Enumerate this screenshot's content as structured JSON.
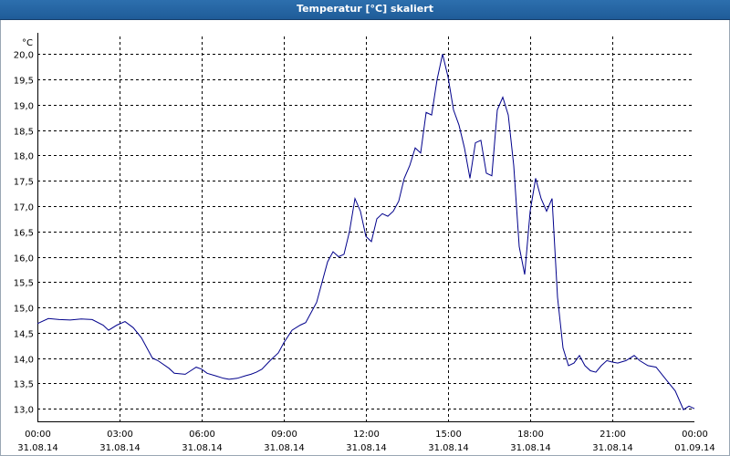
{
  "window": {
    "title": "Temperatur [°C] skaliert"
  },
  "chart_data": {
    "type": "line",
    "title": "Temperatur [°C] skaliert",
    "ylabel": "°C",
    "xlabel": "",
    "ylim": [
      12.75,
      20.35
    ],
    "xlim": [
      0,
      24
    ],
    "grid": true,
    "y_ticks": [
      {
        "value": 13.0,
        "label": "13,0"
      },
      {
        "value": 13.5,
        "label": "13,5"
      },
      {
        "value": 14.0,
        "label": "14,0"
      },
      {
        "value": 14.5,
        "label": "14,5"
      },
      {
        "value": 15.0,
        "label": "15,0"
      },
      {
        "value": 15.5,
        "label": "15,5"
      },
      {
        "value": 16.0,
        "label": "16,0"
      },
      {
        "value": 16.5,
        "label": "16,5"
      },
      {
        "value": 17.0,
        "label": "17,0"
      },
      {
        "value": 17.5,
        "label": "17,5"
      },
      {
        "value": 18.0,
        "label": "18,0"
      },
      {
        "value": 18.5,
        "label": "18,5"
      },
      {
        "value": 19.0,
        "label": "19,0"
      },
      {
        "value": 19.5,
        "label": "19,5"
      },
      {
        "value": 20.0,
        "label": "20,0"
      }
    ],
    "x_ticks": [
      {
        "value": 0,
        "time": "00:00",
        "date": "31.08.14"
      },
      {
        "value": 3,
        "time": "03:00",
        "date": "31.08.14"
      },
      {
        "value": 6,
        "time": "06:00",
        "date": "31.08.14"
      },
      {
        "value": 9,
        "time": "09:00",
        "date": "31.08.14"
      },
      {
        "value": 12,
        "time": "12:00",
        "date": "31.08.14"
      },
      {
        "value": 15,
        "time": "15:00",
        "date": "31.08.14"
      },
      {
        "value": 18,
        "time": "18:00",
        "date": "31.08.14"
      },
      {
        "value": 21,
        "time": "21:00",
        "date": "31.08.14"
      },
      {
        "value": 24,
        "time": "00:00",
        "date": "01.09.14"
      }
    ],
    "colors": {
      "line": "#00008b",
      "grid": "#000000",
      "axis": "#000000"
    },
    "series": [
      {
        "x": [
          0.0,
          0.4,
          0.8,
          1.2,
          1.6,
          2.0,
          2.4,
          2.6,
          2.9,
          3.2,
          3.5,
          3.8,
          4.0,
          4.2,
          4.4,
          4.8,
          5.0,
          5.4,
          5.6,
          5.8,
          6.0,
          6.2,
          6.5,
          6.8,
          7.0,
          7.3,
          7.6,
          7.8,
          8.0,
          8.2,
          8.5,
          8.8,
          9.0,
          9.3,
          9.6,
          9.8,
          10.0,
          10.2,
          10.4,
          10.6,
          10.8,
          11.0,
          11.2,
          11.4,
          11.6,
          11.8,
          12.0,
          12.2,
          12.4,
          12.6,
          12.8,
          13.0,
          13.2,
          13.4,
          13.6,
          13.8,
          14.0,
          14.2,
          14.4,
          14.6,
          14.8,
          15.0,
          15.2,
          15.4,
          15.6,
          15.8,
          16.0,
          16.2,
          16.4,
          16.6,
          16.8,
          17.0,
          17.2,
          17.4,
          17.6,
          17.8,
          18.0,
          18.2,
          18.4,
          18.6,
          18.8,
          19.0,
          19.2,
          19.4,
          19.6,
          19.8,
          20.0,
          20.2,
          20.4,
          20.6,
          20.8,
          21.0,
          21.2,
          21.5,
          21.8,
          22.0,
          22.3,
          22.6,
          23.0,
          23.3,
          23.6,
          23.8,
          24.0
        ],
        "y": [
          14.68,
          14.78,
          14.76,
          14.75,
          14.77,
          14.76,
          14.65,
          14.55,
          14.65,
          14.72,
          14.6,
          14.4,
          14.2,
          14.0,
          13.95,
          13.8,
          13.7,
          13.68,
          13.75,
          13.82,
          13.78,
          13.7,
          13.65,
          13.6,
          13.58,
          13.6,
          13.65,
          13.68,
          13.72,
          13.78,
          13.95,
          14.1,
          14.3,
          14.55,
          14.65,
          14.7,
          14.9,
          15.1,
          15.5,
          15.9,
          16.1,
          16.0,
          16.05,
          16.5,
          17.15,
          16.9,
          16.4,
          16.3,
          16.75,
          16.85,
          16.8,
          16.9,
          17.1,
          17.55,
          17.8,
          18.15,
          18.05,
          18.85,
          18.8,
          19.5,
          20.0,
          19.55,
          18.9,
          18.6,
          18.15,
          17.55,
          18.25,
          18.3,
          17.65,
          17.6,
          18.9,
          19.15,
          18.8,
          17.8,
          16.2,
          15.65,
          16.9,
          17.55,
          17.15,
          16.9,
          17.15,
          15.2,
          14.2,
          13.85,
          13.9,
          14.05,
          13.85,
          13.75,
          13.72,
          13.85,
          13.95,
          13.92,
          13.9,
          13.95,
          14.05,
          13.95,
          13.85,
          13.82,
          13.55,
          13.35,
          12.98,
          13.05,
          13.0
        ]
      }
    ]
  }
}
